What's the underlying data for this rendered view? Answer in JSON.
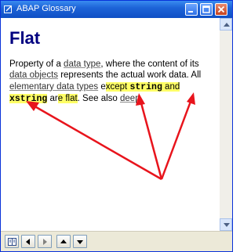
{
  "window": {
    "title": "ABAP Glossary",
    "title_icon": "window-edit-icon"
  },
  "titlebar_buttons": [
    "minimize-icon",
    "maximize-icon",
    "close-icon"
  ],
  "content": {
    "heading": "Flat",
    "paragraph": {
      "t1": "Property of a ",
      "link_data_type": "data type",
      "t2": ", where the content of its ",
      "link_data_objects": "data objects",
      "t3": " represents the actual work data. All ",
      "link_elementary": "elementary data types",
      "t4a": " e",
      "t4b": "xcept ",
      "code_string": "string",
      "t5": " and ",
      "code_xstring": "xstring",
      "t6a": " ar",
      "t6b": "e flat",
      "t7": ". See also ",
      "link_deep": "deep",
      "t8": "."
    },
    "highlight_color": "#ffff66",
    "annotation_color": "#e8141c"
  },
  "toolbar": {
    "buttons": [
      "book-icon",
      "back-icon",
      "forward-icon",
      "up-icon",
      "down-icon"
    ]
  }
}
